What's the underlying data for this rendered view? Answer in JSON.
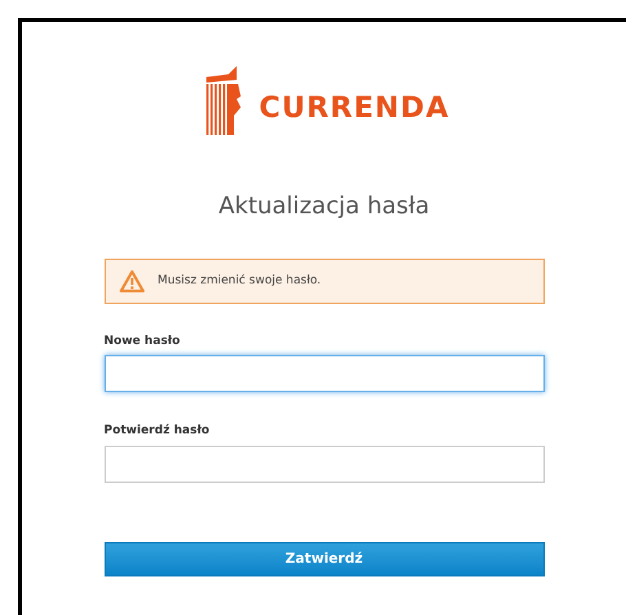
{
  "logo": {
    "text": "CURRENDA"
  },
  "title": "Aktualizacja hasła",
  "alert": {
    "kind": "warning",
    "message": "Musisz zmienić swoje hasło."
  },
  "fields": [
    {
      "label": "Nowe hasło",
      "focused": true
    },
    {
      "label": "Potwierdź hasło",
      "focused": false
    }
  ],
  "submit_button": "Zatwierdź"
}
